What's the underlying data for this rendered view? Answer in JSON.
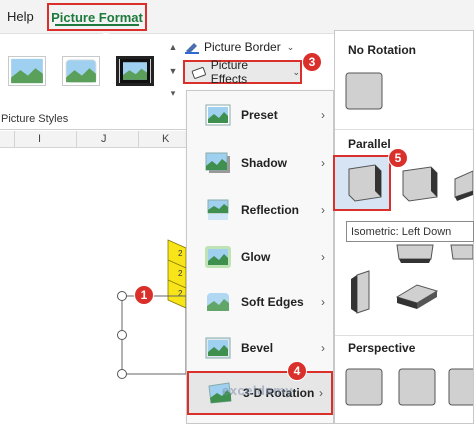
{
  "tabs": {
    "help": "Help",
    "picture_format": "Picture Format"
  },
  "ribbon": {
    "picture_border": "Picture Border",
    "picture_effects": "Picture Effects",
    "picture_styles_label": "Picture Styles"
  },
  "sheet": {
    "columns": [
      "I",
      "J",
      "K"
    ]
  },
  "effects_menu": {
    "items": [
      {
        "label": "Preset",
        "icon": "preset-icon"
      },
      {
        "label": "Shadow",
        "icon": "shadow-icon"
      },
      {
        "label": "Reflection",
        "icon": "reflection-icon"
      },
      {
        "label": "Glow",
        "icon": "glow-icon"
      },
      {
        "label": "Soft Edges",
        "icon": "soft-edges-icon"
      },
      {
        "label": "Bevel",
        "icon": "bevel-icon"
      },
      {
        "label": "3-D Rotation",
        "icon": "3d-rotation-icon"
      }
    ]
  },
  "rotation_gallery": {
    "no_rotation_title": "No Rotation",
    "parallel_title": "Parallel",
    "perspective_title": "Perspective",
    "tooltip": "Isometric: Left Down"
  },
  "badges": [
    "1",
    "2",
    "3",
    "4",
    "5"
  ],
  "watermark": "exceldemy",
  "colors": {
    "accent_red": "#d9302b",
    "tab_green": "#1e7a3c",
    "selected_bg": "#d6e4f4"
  }
}
